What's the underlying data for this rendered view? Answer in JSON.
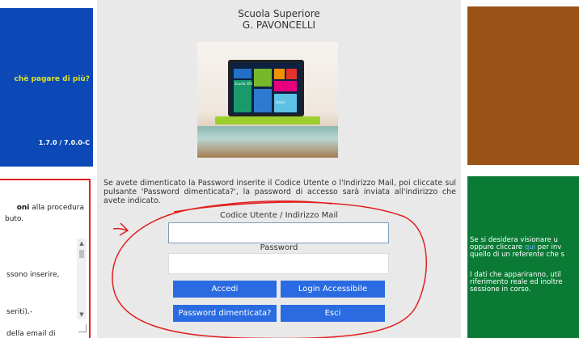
{
  "left_panel": {
    "promo_text": "chè pagare di più?",
    "version": "1.7.0 / 7.0.0-C",
    "text_line1_bold": "oni",
    "text_line1_rest": " alla procedura",
    "text_line2": "buto.",
    "text_line3": "ssono inserire,",
    "text_line4": "seriti).-",
    "text_line5": "della email di"
  },
  "header": {
    "school_line1": "Scuola Superiore",
    "school_line2": "G. PAVONCELLI"
  },
  "photo": {
    "tile_label_1": "Scuola 365",
    "tile_label_2": "classi"
  },
  "login": {
    "info": "Se avete dimenticato la Password inserite il Codice Utente o l'Indirizzo Mail, poi cliccate sul pulsante 'Password dimenticata?', la password di accesso sarà inviata all'indirizzo che avete indicato.",
    "user_label": "Codice Utente / Indirizzo Mail",
    "user_value": "",
    "password_label": "Password",
    "password_value": "",
    "btn_accedi": "Accedi",
    "btn_accessibile": "Login Accessibile",
    "btn_dimenticata": "Password dimenticata?",
    "btn_esci": "Esci"
  },
  "right_panel": {
    "line1": "Se si desidera visionare u",
    "line2_a": "oppure cliccare ",
    "line2_link": "qui",
    "line2_b": " per inv",
    "line3": "quello di un referente che s",
    "line4": "I dati che appariranno, util",
    "line5": "riferimento reale ed inoltre",
    "line6": "sessione in corso."
  },
  "colors": {
    "left_blue": "#0c49b7",
    "brown": "#9a5216",
    "green": "#0a7a35",
    "button_blue": "#2a6be2",
    "annotation_red": "#e0201f"
  }
}
